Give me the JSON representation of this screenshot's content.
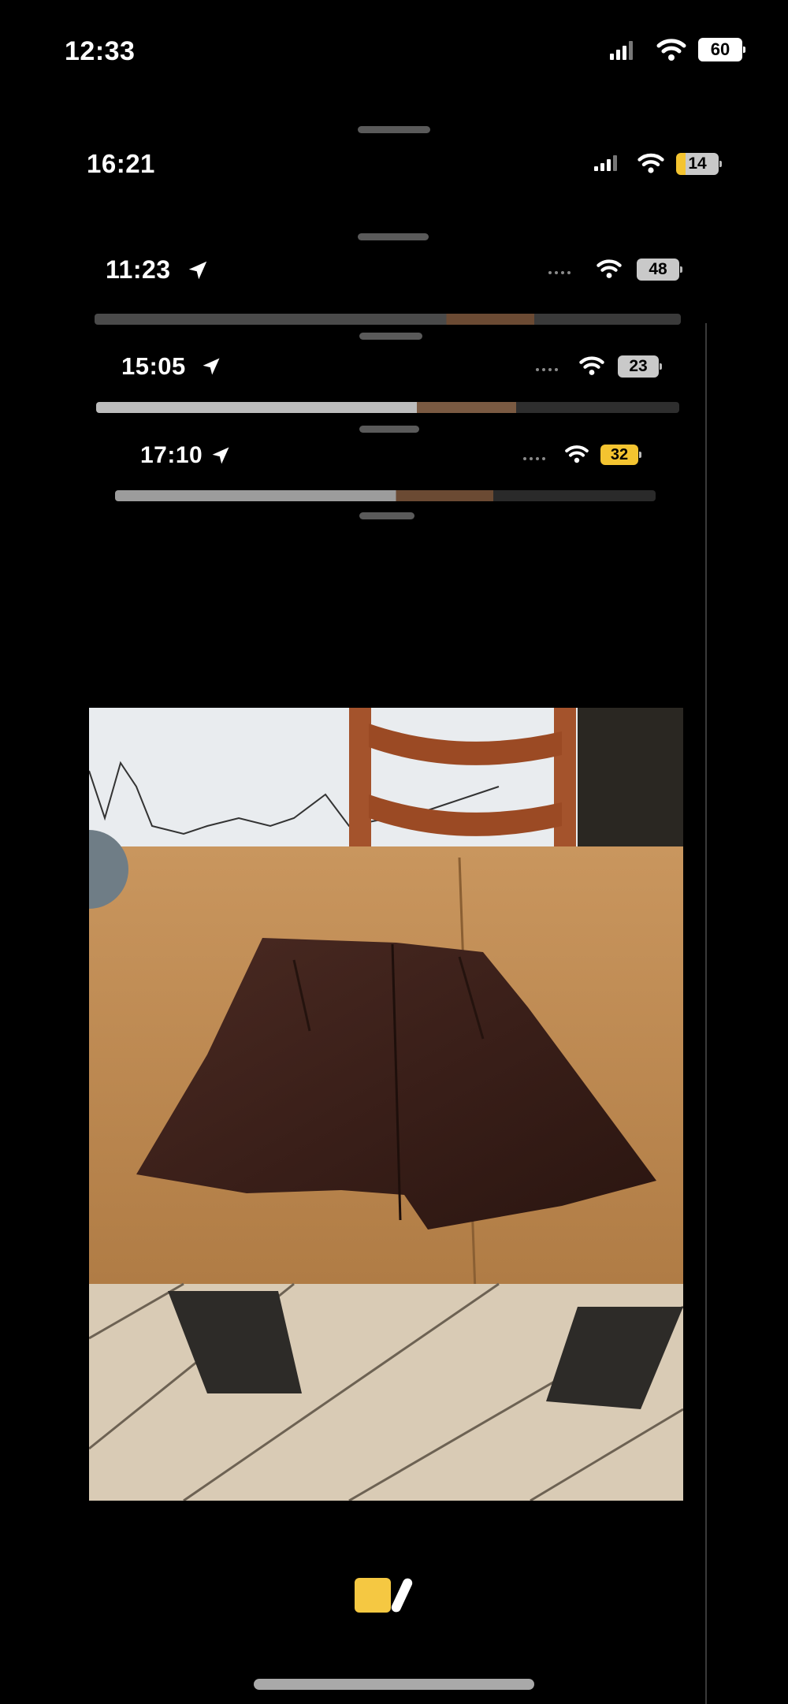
{
  "status_bars": [
    {
      "time": "12:33",
      "battery": "60"
    },
    {
      "time": "16:21",
      "battery": "14"
    },
    {
      "time": "11:23",
      "battery": "48"
    },
    {
      "time": "15:05",
      "battery": "23"
    },
    {
      "time": "17:10",
      "battery": "32"
    }
  ],
  "colors": {
    "background": "#000000",
    "battery_white": "#ffffff",
    "battery_gray": "#c9c9c9",
    "battery_yellow": "#f4c430",
    "accent_yellow": "#f5c842"
  },
  "icons": [
    "signal-icon",
    "wifi-icon",
    "battery-icon",
    "location-arrow-icon",
    "pencil-icon"
  ],
  "photo": {
    "subject": "brown-leather-shorts-on-wooden-table"
  }
}
